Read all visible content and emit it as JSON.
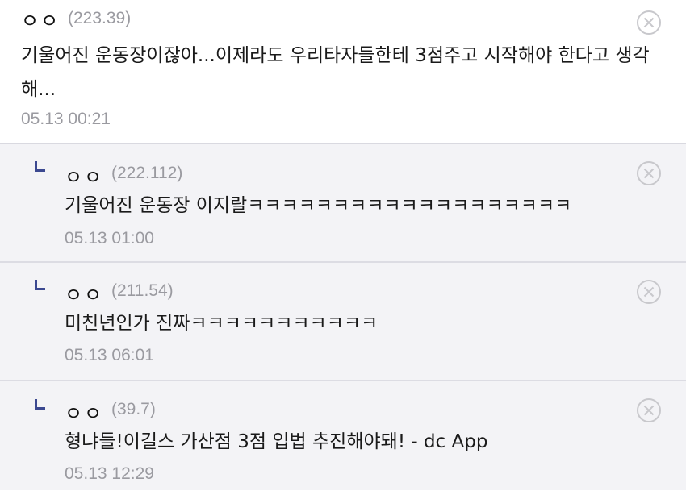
{
  "comments": [
    {
      "author": "ㅇㅇ",
      "ip": "(223.39)",
      "text": "기울어진 운동장이잖아...이제라도 우리타자들한테 3점주고 시작해야 한다고 생각해...",
      "date": "05.13 00:21",
      "is_reply": false
    },
    {
      "author": "ㅇㅇ",
      "ip": "(222.112)",
      "text": "기울어진 운동장 이지랄ㅋㅋㅋㅋㅋㅋㅋㅋㅋㅋㅋㅋㅋㅋㅋㅋㅋㅋㅋ",
      "date": "05.13 01:00",
      "is_reply": true
    },
    {
      "author": "ㅇㅇ",
      "ip": "(211.54)",
      "text": "미친년인가 진짜ㅋㅋㅋㅋㅋㅋㅋㅋㅋㅋㅋ",
      "date": "05.13 06:01",
      "is_reply": true
    },
    {
      "author": "ㅇㅇ",
      "ip": "(39.7)",
      "text": "형냐들!이길스 가산점 3점 입법 추진해야돼! - dc App",
      "date": "05.13 12:29",
      "is_reply": true
    }
  ],
  "icons": {
    "delete": "close-circle-icon",
    "reply_marker": "reply-arrow-icon"
  },
  "colors": {
    "reply_background": "#f3f3f6",
    "reply_marker": "#3b4890",
    "meta_text": "#9a9aa0"
  }
}
